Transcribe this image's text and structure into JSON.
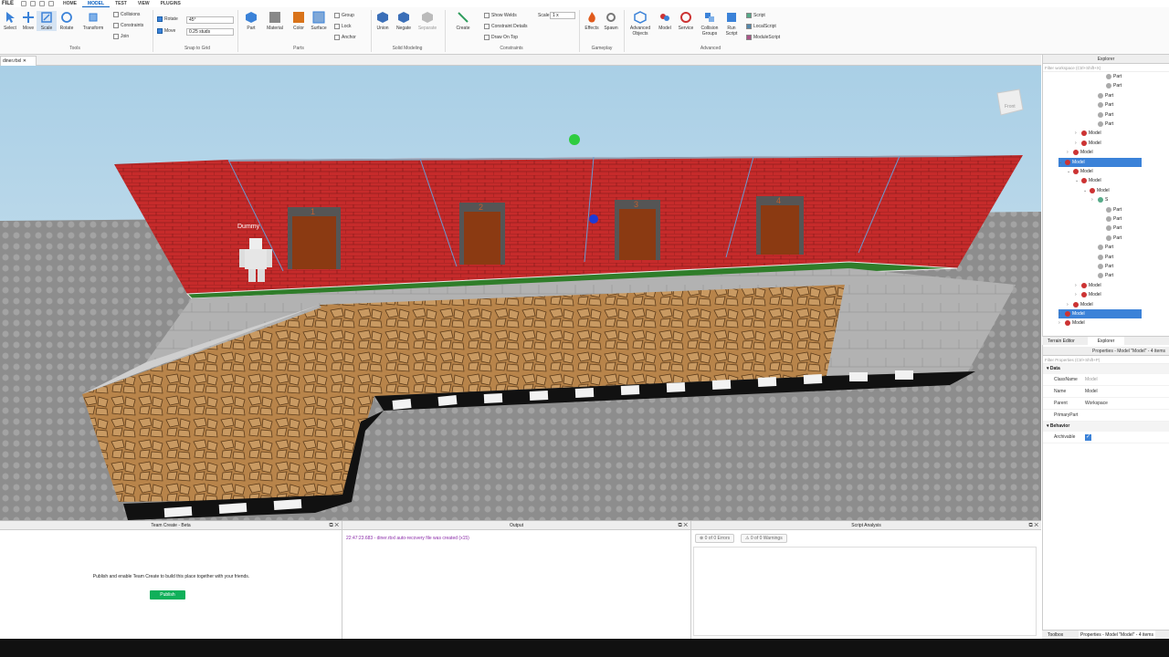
{
  "menu": {
    "file": "FILE",
    "tabs": [
      "HOME",
      "MODEL",
      "TEST",
      "VIEW",
      "PLUGINS"
    ],
    "active_tab": "MODEL"
  },
  "ribbon": {
    "tools": {
      "select": "Select",
      "move": "Move",
      "scale": "Scale",
      "rotate": "Rotate",
      "transform": "Transform",
      "group_label": "Tools"
    },
    "collisions": "Collisions",
    "constraints": "Constraints",
    "join": "Join",
    "snap": {
      "rotate_label": "Rotate",
      "rotate_value": "45°",
      "move_label": "Move",
      "move_value": "0.25 studs",
      "group_label": "Snap to Grid"
    },
    "parts": {
      "part": "Part",
      "material": "Material",
      "color": "Color",
      "surface": "Surface",
      "group": "Group",
      "lock": "Lock",
      "anchor": "Anchor",
      "group_label": "Parts"
    },
    "solid": {
      "union": "Union",
      "negate": "Negate",
      "separate": "Separate",
      "group_label": "Solid Modeling"
    },
    "constraints_grp": {
      "create": "Create",
      "show_welds": "Show Welds",
      "constraint_details": "Constraint Details",
      "draw_on_top": "Draw On Top",
      "scale_label": "Scale",
      "scale_value": "1 x",
      "group_label": "Constraints"
    },
    "gameplay": {
      "effects": "Effects",
      "spawn": "Spawn",
      "group_label": "Gameplay"
    },
    "advanced": {
      "advanced_objects": "Advanced Objects",
      "model": "Model",
      "service": "Service",
      "collision_groups": "Collision Groups",
      "run_script": "Run Script",
      "script": "Script",
      "localscript": "LocalScript",
      "modulescript": "ModuleScript",
      "group_label": "Advanced"
    }
  },
  "viewport_tab": "diner.rbxl",
  "scene": {
    "dummy_label": "Dummy",
    "door_numbers": [
      "1",
      "2",
      "3",
      "4"
    ],
    "view_cube_label": "Front"
  },
  "explorer": {
    "title": "Explorer",
    "filter_placeholder": "Filter workspace (Ctrl+Shift+X)",
    "rows": [
      {
        "label": "Part",
        "indent": 6,
        "type": "part"
      },
      {
        "label": "Part",
        "indent": 6,
        "type": "part"
      },
      {
        "label": "Part",
        "indent": 5,
        "type": "part"
      },
      {
        "label": "Part",
        "indent": 5,
        "type": "part"
      },
      {
        "label": "Part",
        "indent": 5,
        "type": "part"
      },
      {
        "label": "Part",
        "indent": 5,
        "type": "part"
      },
      {
        "label": "Model",
        "indent": 3,
        "type": "model",
        "chev": ">"
      },
      {
        "label": "Model",
        "indent": 3,
        "type": "model",
        "chev": ">"
      },
      {
        "label": "Model",
        "indent": 2,
        "type": "model",
        "chev": ">"
      },
      {
        "label": "Model",
        "indent": 1,
        "type": "model",
        "chev": "v",
        "selected": true
      },
      {
        "label": "Model",
        "indent": 2,
        "type": "model",
        "chev": "v"
      },
      {
        "label": "Model",
        "indent": 3,
        "type": "model",
        "chev": "v"
      },
      {
        "label": "Model",
        "indent": 4,
        "type": "model",
        "chev": "v"
      },
      {
        "label": "S",
        "indent": 5,
        "type": "script",
        "chev": ">"
      },
      {
        "label": "Part",
        "indent": 6,
        "type": "part"
      },
      {
        "label": "Part",
        "indent": 6,
        "type": "part"
      },
      {
        "label": "Part",
        "indent": 6,
        "type": "part"
      },
      {
        "label": "Part",
        "indent": 6,
        "type": "part"
      },
      {
        "label": "Part",
        "indent": 5,
        "type": "part"
      },
      {
        "label": "Part",
        "indent": 5,
        "type": "part"
      },
      {
        "label": "Part",
        "indent": 5,
        "type": "part"
      },
      {
        "label": "Part",
        "indent": 5,
        "type": "part"
      },
      {
        "label": "Model",
        "indent": 3,
        "type": "model",
        "chev": ">"
      },
      {
        "label": "Model",
        "indent": 3,
        "type": "model",
        "chev": ">"
      },
      {
        "label": "Model",
        "indent": 2,
        "type": "model",
        "chev": ">"
      },
      {
        "label": "Model",
        "indent": 1,
        "type": "model",
        "chev": ">",
        "selected": true
      },
      {
        "label": "Model",
        "indent": 1,
        "type": "model",
        "chev": ">"
      }
    ]
  },
  "bottom_tabs": {
    "terrain": "Terrain Editor",
    "explorer": "Explorer"
  },
  "properties": {
    "title": "Properties - Model \"Model\" - 4 items",
    "filter_placeholder": "Filter Properties (Ctrl+Shift+P)",
    "data_label": "Data",
    "rows": [
      {
        "k": "ClassName",
        "v": "Model"
      },
      {
        "k": "Name",
        "v": "Model"
      },
      {
        "k": "Parent",
        "v": "Workspace"
      },
      {
        "k": "PrimaryPart",
        "v": ""
      }
    ],
    "behavior_label": "Behavior",
    "archivable_label": "Archivable"
  },
  "statusbar": {
    "toolbox": "Toolbox",
    "props": "Properties - Model \"Model\" - 4 items"
  },
  "team_create": {
    "title": "Team Create - Beta",
    "message": "Publish and enable Team Create to build this place together with your friends.",
    "publish": "Publish"
  },
  "output": {
    "title": "Output",
    "line": "22:47:23.683 - diner.rbxl auto-recovery file was created (x15)"
  },
  "script_analysis": {
    "title": "Script Analysis",
    "errors": "0 of 0 Errors",
    "warnings": "0 of 0 Warnings"
  },
  "colors": {
    "accent": "#3b82d8",
    "publish": "#10b05a",
    "brick": "#c62b2b",
    "grass": "#2f7d2a"
  }
}
